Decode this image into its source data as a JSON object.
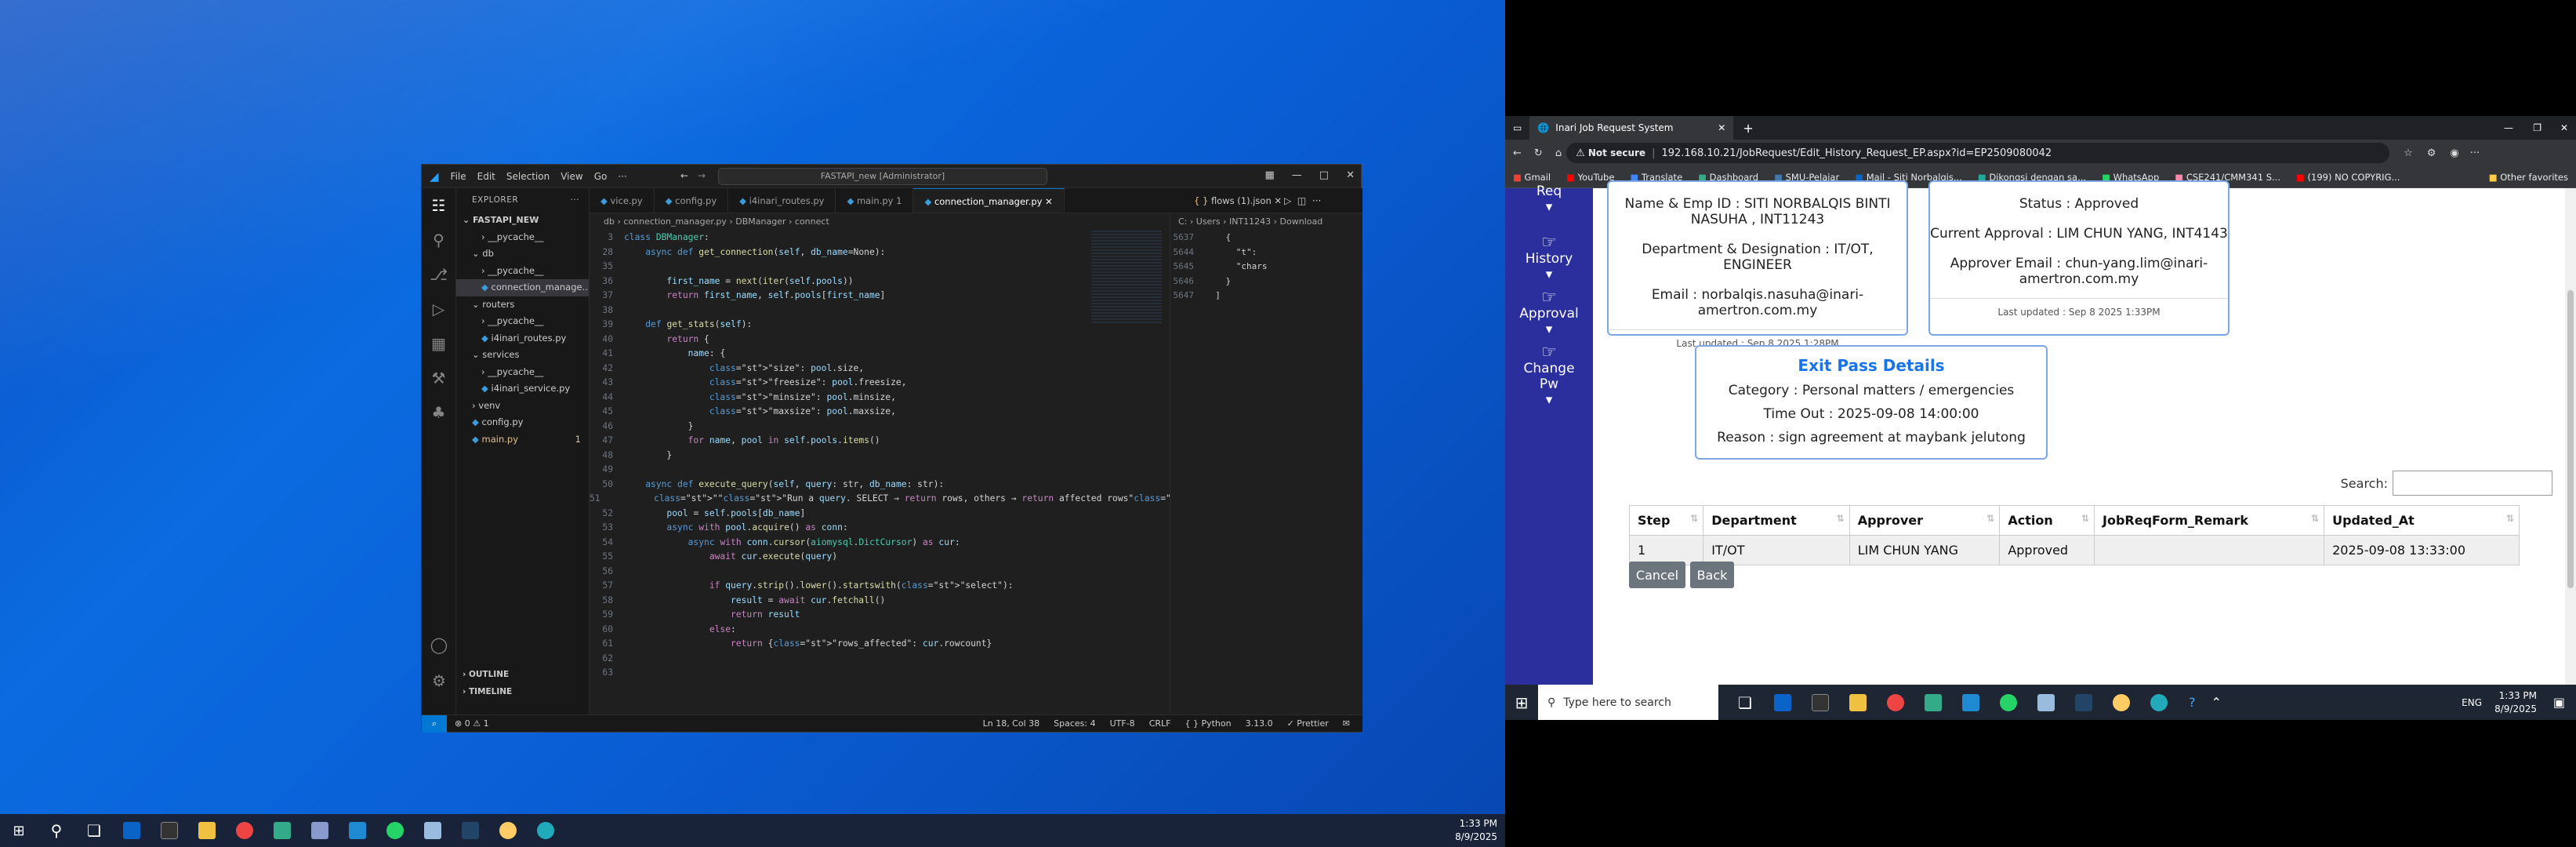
{
  "vscode": {
    "menu": [
      "File",
      "Edit",
      "Selection",
      "View",
      "Go",
      "···"
    ],
    "search": "FASTAPI_new [Administrator]",
    "explorer_title": "EXPLORER",
    "project": "FASTAPI_NEW",
    "tree": [
      {
        "label": "__pycache__",
        "indent": 2,
        "type": "folder"
      },
      {
        "label": "db",
        "indent": 1,
        "type": "folder-open"
      },
      {
        "label": "__pycache__",
        "indent": 2,
        "type": "folder"
      },
      {
        "label": "connection_manage...",
        "indent": 2,
        "type": "file",
        "selected": true
      },
      {
        "label": "routers",
        "indent": 1,
        "type": "folder-open"
      },
      {
        "label": "__pycache__",
        "indent": 2,
        "type": "folder"
      },
      {
        "label": "i4inari_routes.py",
        "indent": 2,
        "type": "file"
      },
      {
        "label": "services",
        "indent": 1,
        "type": "folder-open"
      },
      {
        "label": "__pycache__",
        "indent": 2,
        "type": "folder"
      },
      {
        "label": "i4inari_service.py",
        "indent": 2,
        "type": "file"
      },
      {
        "label": "venv",
        "indent": 1,
        "type": "folder"
      },
      {
        "label": "config.py",
        "indent": 1,
        "type": "file"
      },
      {
        "label": "main.py",
        "indent": 1,
        "type": "file",
        "warn": true,
        "badge": "1"
      }
    ],
    "outline": "OUTLINE",
    "timeline": "TIMELINE",
    "tabs": [
      {
        "label": "vice.py"
      },
      {
        "label": "config.py"
      },
      {
        "label": "i4inari_routes.py"
      },
      {
        "label": "main.py  1"
      },
      {
        "label": "connection_manager.py",
        "active": true
      }
    ],
    "right_tab": "flows (1).json",
    "breadcrumb": "db › connection_manager.py › DBManager › connect",
    "right_breadcrumb": "C: › Users › INT11243 › Download",
    "code": [
      {
        "n": "3",
        "t": "class DBManager:"
      },
      {
        "n": "28",
        "t": "    async def get_connection(self, db_name=None):"
      },
      {
        "n": "35",
        "t": ""
      },
      {
        "n": "36",
        "t": "        first_name = next(iter(self.pools))"
      },
      {
        "n": "37",
        "t": "        return first_name, self.pools[first_name]"
      },
      {
        "n": "38",
        "t": ""
      },
      {
        "n": "39",
        "t": "    def get_stats(self):"
      },
      {
        "n": "40",
        "t": "        return {"
      },
      {
        "n": "41",
        "t": "            name: {"
      },
      {
        "n": "42",
        "t": "                \"size\": pool.size,"
      },
      {
        "n": "43",
        "t": "                \"freesize\": pool.freesize,"
      },
      {
        "n": "44",
        "t": "                \"minsize\": pool.minsize,"
      },
      {
        "n": "45",
        "t": "                \"maxsize\": pool.maxsize,"
      },
      {
        "n": "46",
        "t": "            }"
      },
      {
        "n": "47",
        "t": "            for name, pool in self.pools.items()"
      },
      {
        "n": "48",
        "t": "        }"
      },
      {
        "n": "49",
        "t": ""
      },
      {
        "n": "50",
        "t": "    async def execute_query(self, query: str, db_name: str):"
      },
      {
        "n": "51",
        "t": "        \"\"\"Run a query. SELECT → return rows, others → return affected rows\"\"\""
      },
      {
        "n": "52",
        "t": "        pool = self.pools[db_name]"
      },
      {
        "n": "53",
        "t": "        async with pool.acquire() as conn:"
      },
      {
        "n": "54",
        "t": "            async with conn.cursor(aiomysql.DictCursor) as cur:"
      },
      {
        "n": "55",
        "t": "                await cur.execute(query)"
      },
      {
        "n": "56",
        "t": ""
      },
      {
        "n": "57",
        "t": "                if query.strip().lower().startswith(\"select\"):"
      },
      {
        "n": "58",
        "t": "                    result = await cur.fetchall()"
      },
      {
        "n": "59",
        "t": "                    return result"
      },
      {
        "n": "60",
        "t": "                else:"
      },
      {
        "n": "61",
        "t": "                    return {\"rows_affected\": cur.rowcount}"
      },
      {
        "n": "62",
        "t": ""
      },
      {
        "n": "63",
        "t": ""
      }
    ],
    "right_code": [
      {
        "n": "5637",
        "t": "    {"
      },
      {
        "n": "5644",
        "t": "      \"t\":"
      },
      {
        "n": "5645",
        "t": "      \"chars"
      },
      {
        "n": "5646",
        "t": "    }"
      },
      {
        "n": "5647",
        "t": "  ]"
      }
    ],
    "status": {
      "errors": "⊗ 0 ⚠ 1",
      "ln": "Ln 18, Col 38",
      "spaces": "Spaces: 4",
      "enc": "UTF-8",
      "eol": "CRLF",
      "lang": "{ } Python",
      "ver": "3.13.0",
      "prettier": "✓ Prettier"
    }
  },
  "browser": {
    "tab_title": "Inari Job Request System",
    "not_secure": "Not secure",
    "url": "192.168.10.21/JobRequest/Edit_History_Request_EP.aspx?id=EP2509080042",
    "bookmarks": [
      "Gmail",
      "YouTube",
      "Translate",
      "Dashboard",
      "SMU-Pelajar",
      "Mail - Siti Norbalqis...",
      "Dikongsi dengan sa...",
      "WhatsApp",
      "CSE241/CMM341 S...",
      "(199) NO COPYRIG...",
      "Other favorites"
    ],
    "sidebar": [
      {
        "label": "Req",
        "icon": "hand-point-icon"
      },
      {
        "label": "History",
        "icon": "hand-point-icon"
      },
      {
        "label": "Approval",
        "icon": "hand-point-icon"
      },
      {
        "label": "Change Pw",
        "icon": "hand-point-icon"
      }
    ],
    "employee": {
      "name": "Name & Emp ID : SITI NORBALQIS BINTI NASUHA , INT11243",
      "dept": "Department & Designation : IT/OT, ENGINEER",
      "email": "Email : norbalqis.nasuha@inari-amertron.com.my",
      "updated": "Last updated : Sep 8 2025 1:28PM"
    },
    "status": {
      "status": "Status : Approved",
      "current": "Current Approval : LIM CHUN YANG, INT4143",
      "email": "Approver Email : chun-yang.lim@inari-amertron.com.my",
      "updated": "Last updated : Sep 8 2025 1:33PM"
    },
    "exit": {
      "title": "Exit Pass Details",
      "category": "Category : Personal matters / emergencies",
      "time": "Time Out : 2025-09-08 14:00:00",
      "reason": "Reason : sign agreement at maybank jelutong"
    },
    "search_label": "Search:",
    "table": {
      "headers": [
        "Step",
        "Department",
        "Approver",
        "Action",
        "JobReqForm_Remark",
        "Updated_At"
      ],
      "rows": [
        [
          "1",
          "IT/OT",
          "LIM CHUN YANG",
          "Approved",
          "",
          "2025-09-08 13:33:00"
        ]
      ]
    },
    "cancel": "Cancel",
    "back": "Back"
  },
  "taskbar": {
    "time": "1:33 PM",
    "date": "8/9/2025",
    "search_placeholder": "Type here to search",
    "lang": "ENG"
  }
}
